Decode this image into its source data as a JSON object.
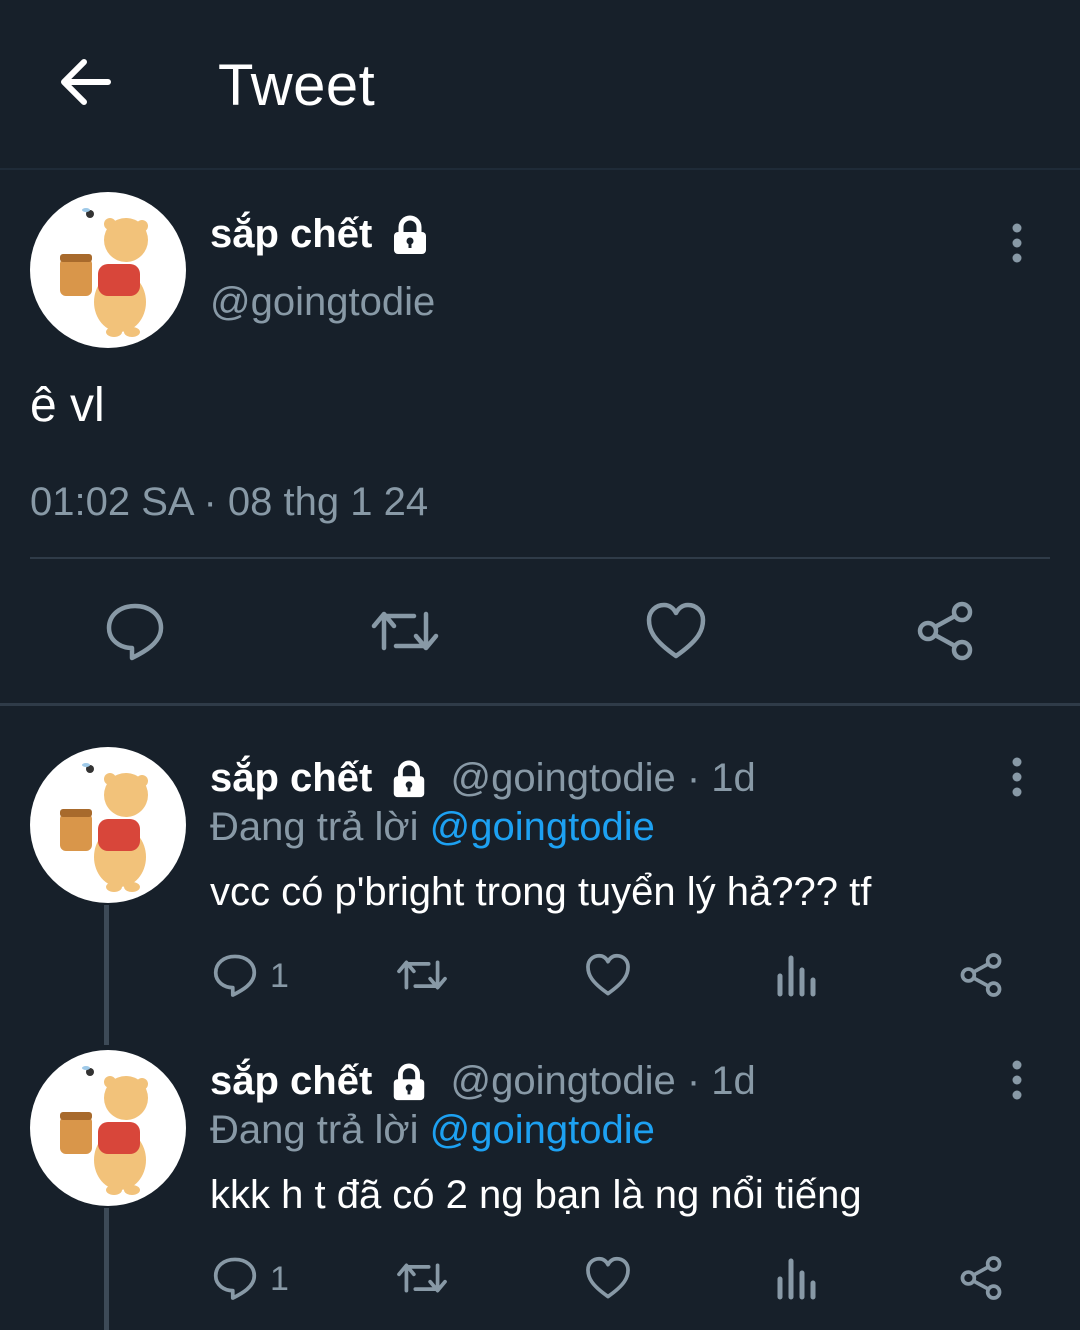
{
  "header": {
    "title": "Tweet"
  },
  "main_tweet": {
    "display_name": "sắp chết",
    "handle": "@goingtodie",
    "text": "ê vl",
    "timestamp": "01:02 SA · 08 thg 1 24"
  },
  "replies": [
    {
      "display_name": "sắp chết",
      "handle": "@goingtodie · 1d",
      "replying_label": "Đang trả lời",
      "replying_to": "@goingtodie",
      "text": "vcc có p'bright trong tuyển lý hả??? tf",
      "reply_count": "1"
    },
    {
      "display_name": "sắp chết",
      "handle": "@goingtodie · 1d",
      "replying_label": "Đang trả lời",
      "replying_to": "@goingtodie",
      "text": "kkk h t đã có 2 ng bạn là ng nổi tiếng",
      "reply_count": "1"
    }
  ],
  "icons": {
    "back": "arrow-left-icon",
    "lock": "lock-icon",
    "more": "more-vertical-icon",
    "reply": "comment-icon",
    "retweet": "retweet-icon",
    "like": "heart-icon",
    "share": "share-icon",
    "analytics": "analytics-icon"
  },
  "colors": {
    "background": "#17202a",
    "secondary_text": "#8899a6",
    "link": "#1da1f2"
  }
}
